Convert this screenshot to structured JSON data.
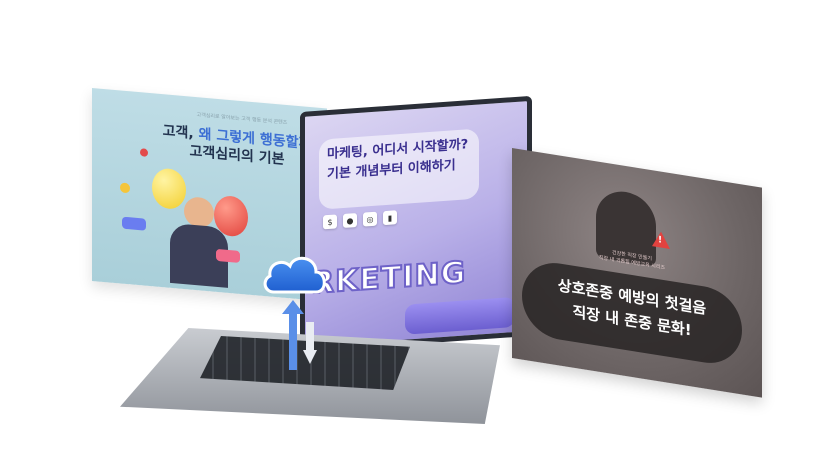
{
  "left_card": {
    "caption": "고객심리로 알아보는 고객 행동 분석 콘텐츠",
    "title_line1_a": "고객, ",
    "title_line1_b": "왜 그렇게 행동할까",
    "title_line2": "고객심리의 기본"
  },
  "center_card": {
    "title_line1": "마케팅, 어디서 시작할까?",
    "title_line2": "기본 개념부터 이해하기",
    "word": "RKETING"
  },
  "right_card": {
    "caption_line1": "건강한 직장 만들기",
    "caption_line2": "직장 내 괴롭힘 예방교육 시리즈",
    "title_line1": "상호존중 예방의 첫걸음",
    "title_line2": "직장 내 존중 문화!",
    "warning_mark": "!"
  },
  "colors": {
    "cloud": "#2f72e0",
    "arrow": "#5a8fe8",
    "left_bg": "#bfdde6",
    "screen_bg": "#b9b0e8",
    "right_bg": "#6e6666"
  },
  "icons": [
    "cloud-upload-icon",
    "upload-arrow-icon",
    "warning-icon"
  ]
}
